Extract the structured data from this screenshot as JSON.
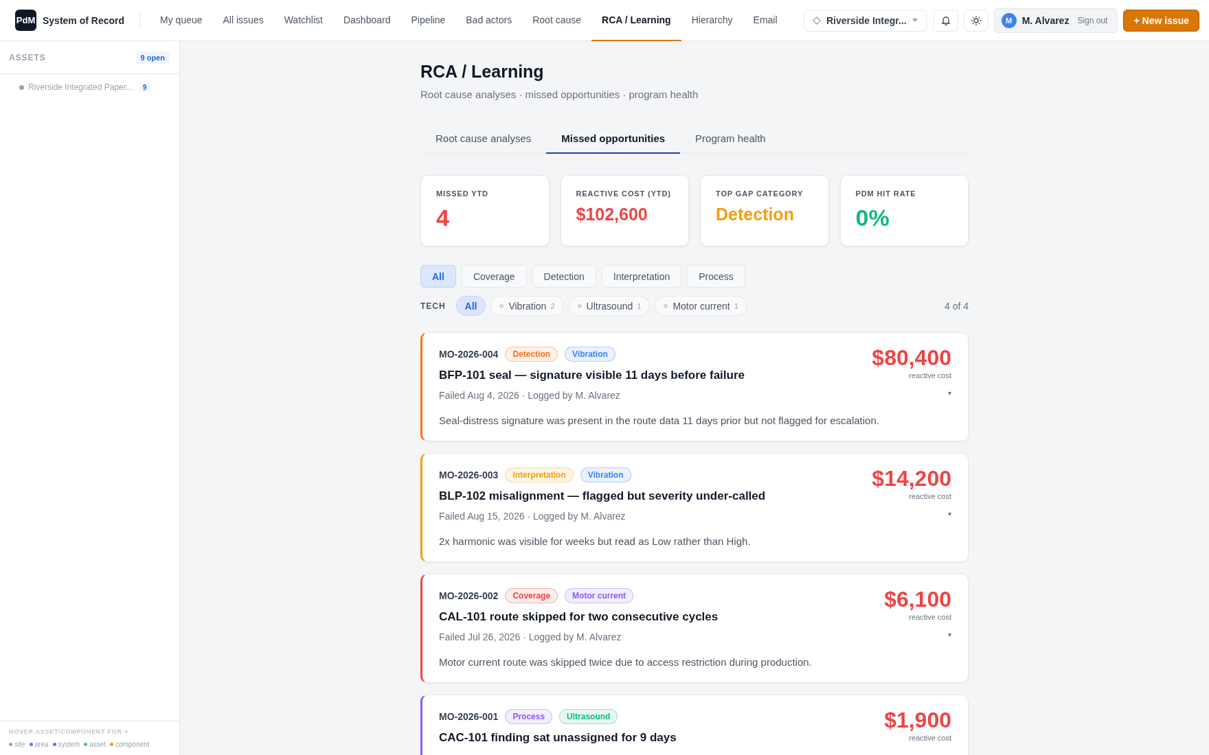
{
  "brand": {
    "logo": "PdM",
    "name": "System of Record"
  },
  "nav": [
    {
      "label": "My queue",
      "selected": false
    },
    {
      "label": "All issues",
      "selected": false
    },
    {
      "label": "Watchlist",
      "selected": false
    },
    {
      "label": "Dashboard",
      "selected": false
    },
    {
      "label": "Pipeline",
      "selected": false
    },
    {
      "label": "Bad actors",
      "selected": false
    },
    {
      "label": "Root cause",
      "selected": false
    },
    {
      "label": "RCA / Learning",
      "selected": true
    },
    {
      "label": "Hierarchy",
      "selected": false
    },
    {
      "label": "Email",
      "selected": false
    }
  ],
  "site_selector": {
    "value": "Riverside Integr..."
  },
  "user": {
    "initial": "M",
    "name": "M. Alvarez",
    "sign_out": "Sign out"
  },
  "new_issue": "+ New issue",
  "sidebar": {
    "title": "ASSETS",
    "badge": "9 open",
    "items": [
      {
        "label": "Riverside Integrated Paper...",
        "count": "9"
      }
    ],
    "legend_title": "HOVER ASSET/COMPONENT FOR +",
    "legend": [
      {
        "label": "site",
        "color": "#9ca3af"
      },
      {
        "label": "area",
        "color": "#3b82f6"
      },
      {
        "label": "system",
        "color": "#8b5cf6"
      },
      {
        "label": "asset",
        "color": "#34d399"
      },
      {
        "label": "component",
        "color": "#f59e0b"
      }
    ]
  },
  "page": {
    "title": "RCA / Learning",
    "subtitle": "Root cause analyses · missed opportunities · program health"
  },
  "tabs": [
    {
      "label": "Root cause analyses",
      "selected": false
    },
    {
      "label": "Missed opportunities",
      "selected": true
    },
    {
      "label": "Program health",
      "selected": false
    }
  ],
  "stats": [
    {
      "label": "MISSED YTD",
      "value": "4",
      "color": "#ef4444"
    },
    {
      "label": "REACTIVE COST (YTD)",
      "value": "$102,600",
      "color": "#ef4444"
    },
    {
      "label": "TOP GAP CATEGORY",
      "value": "Detection",
      "color": "#f59e0b"
    },
    {
      "label": "PDM HIT RATE",
      "value": "0%",
      "color": "#10b981"
    }
  ],
  "category_filters": [
    {
      "label": "All",
      "selected": true
    },
    {
      "label": "Coverage",
      "selected": false
    },
    {
      "label": "Detection",
      "selected": false
    },
    {
      "label": "Interpretation",
      "selected": false
    },
    {
      "label": "Process",
      "selected": false
    }
  ],
  "tech_filter": {
    "label": "TECH",
    "options": [
      {
        "label": "All",
        "selected": true
      },
      {
        "label": "Vibration",
        "count": "2",
        "selected": false
      },
      {
        "label": "Ultrasound",
        "count": "1",
        "selected": false
      },
      {
        "label": "Motor current",
        "count": "1",
        "selected": false
      }
    ],
    "result_count": "4 of 4"
  },
  "items": [
    {
      "id": "MO-2026-004",
      "category": "Detection",
      "color": "#f97316",
      "tech": {
        "label": "Vibration",
        "color": "#3b82f6"
      },
      "title": "BFP-101 seal — signature visible 11 days before failure",
      "meta": "Failed Aug 4, 2026 · Logged by M. Alvarez",
      "cost": "$80,400",
      "cost_label": "reactive cost",
      "toggle": "▾",
      "description": "Seal-distress signature was present in the route data 11 days prior but not flagged for escalation."
    },
    {
      "id": "MO-2026-003",
      "category": "Interpretation",
      "color": "#f59e0b",
      "tech": {
        "label": "Vibration",
        "color": "#3b82f6"
      },
      "title": "BLP-102 misalignment — flagged but severity under-called",
      "meta": "Failed Aug 15, 2026 · Logged by M. Alvarez",
      "cost": "$14,200",
      "cost_label": "reactive cost",
      "toggle": "▾",
      "description": "2x harmonic was visible for weeks but read as Low rather than High."
    },
    {
      "id": "MO-2026-002",
      "category": "Coverage",
      "color": "#ef4444",
      "tech": {
        "label": "Motor current",
        "color": "#8b5cf6"
      },
      "title": "CAL-101 route skipped for two consecutive cycles",
      "meta": "Failed Jul 26, 2026 · Logged by M. Alvarez",
      "cost": "$6,100",
      "cost_label": "reactive cost",
      "toggle": "▾",
      "description": "Motor current route was skipped twice due to access restriction during production."
    },
    {
      "id": "MO-2026-001",
      "category": "Process",
      "color": "#8b5cf6",
      "tech": {
        "label": "Ultrasound",
        "color": "#10b981"
      },
      "title": "CAC-101 finding sat unassigned for 9 days",
      "cost": "$1,900",
      "cost_label": "reactive cost"
    }
  ]
}
